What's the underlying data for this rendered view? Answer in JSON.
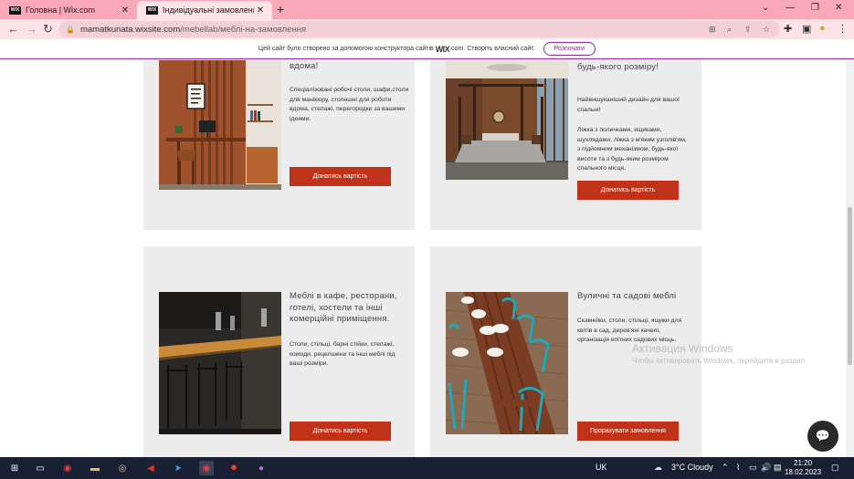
{
  "browser": {
    "tabs": [
      {
        "label": "Головна | Wix.com",
        "favicon": "WIX"
      },
      {
        "label": "Індивідуальні замовлення | Wo",
        "favicon": "WIX"
      }
    ],
    "address": {
      "domain": "mamatkunata.wixsite.com",
      "path": "/mebellab/меблі-на-замовлення"
    }
  },
  "wix_banner": {
    "text_before": "Цей сайт було створено за допомогою конструктора сайтів",
    "brand": "WIX",
    "text_after": ".com. Створіть власний сайт.",
    "button": "Розпочати"
  },
  "cards": [
    {
      "title": "вдома!",
      "description": "Спеціалізовані робочі столи, шафи,столи для манікюру, столешні для роботи вдома, стелажі, перегородки за вашими ідеями.",
      "button": "Дізнатись вартість"
    },
    {
      "title": "шухлядами та поличками будь-якого розміру!",
      "description_1": "Найвишуканіший дизайн для вашої спальні!",
      "description_2": "Ліжка з поличками, ящиками, шухлядами, ліжка з м'яким узголів'ям, з підйомним механізмом; будь-якої висоти та з будь-яким розміром спального місця.",
      "button": "Дізнатись вартість"
    },
    {
      "title": "Меблі в кафе, ресторани, готелі, хостели та інші комерційні приміщення.",
      "description": "Столи, стільці, барні стійки, стелажі, комоди, рецепшени та інші меблі під ваші розміри.",
      "button": "Дізнатись вартість"
    },
    {
      "title": "Вуличні та садові меблі",
      "description": "Скамейки, столи, стільці, ящики для квітів в сад, дерев'яні качелі, організація епітних садових місць.",
      "button": "Прорахувати замовлення"
    }
  ],
  "watermark": {
    "line1": "Активация Windows",
    "line2": "Чтобы активировать Windows, перейдите в раздел"
  },
  "taskbar": {
    "lang": "UK",
    "weather": "3°C  Cloudy",
    "time": "21:20",
    "date": "18.02.2023"
  },
  "colors": {
    "accent": "#c0321a",
    "tab_bar": "#f8a8b8",
    "card_bg": "#ececec",
    "wix_purple": "#8a2c9a"
  }
}
